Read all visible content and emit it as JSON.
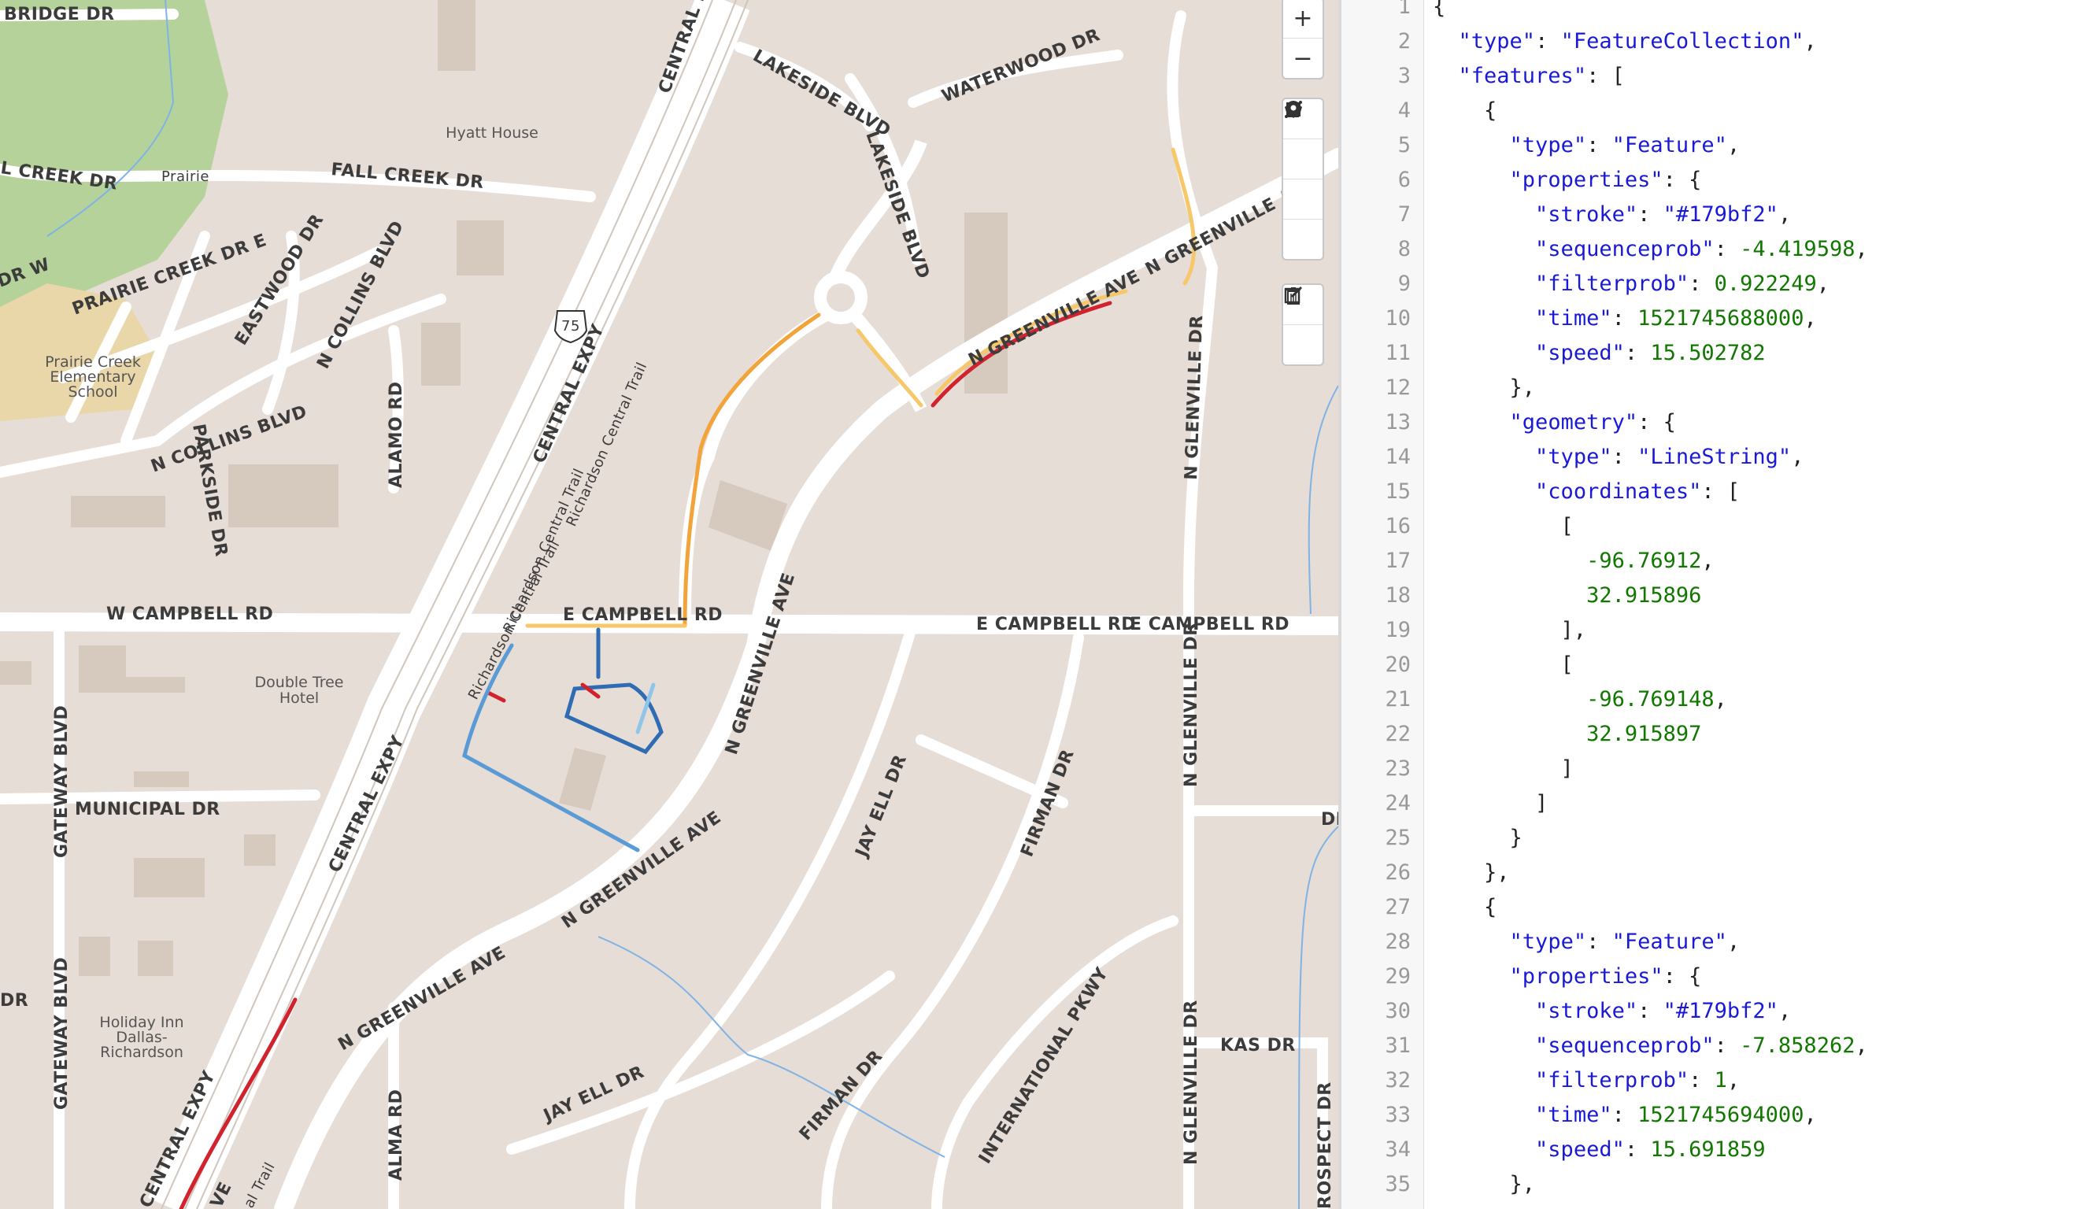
{
  "map": {
    "streets": {
      "bridge_dr": "BRIDGE DR",
      "fall_creek_dr_left": "L CREEK DR",
      "prairie_label": "Prairie",
      "fall_creek_dr": "FALL CREEK DR",
      "prairie_creek_dr_e": "PRAIRIE CREEK DR E",
      "prairie_creek_dr_w": "DR W",
      "eastwood_dr": "EASTWOOD DR",
      "n_collins_blvd_vertical": "N COLLINS BLVD",
      "parkside_dr": "PARKSIDE DR",
      "n_collins_blvd": "N COLLINS BLVD",
      "alamo_rd": "ALAMO RD",
      "central_expy_top": "CENTRAL EX",
      "central_expy_mid": "CENTRAL EXPY",
      "central_expy_low": "CENTRAL EXPY",
      "central_expy_bottom": "CENTRAL EXPY",
      "richardson_trail_1": "Richardson Central Trail",
      "richardson_trail_2": "Richardson Central Trail",
      "richardson_trail_3": "Richardson Central Trail",
      "richardson_trail_4": "al Trail",
      "lakeside_blvd_1": "LAKESIDE BLVD",
      "lakeside_blvd_2": "LAKESIDE BLVD",
      "waterwood_dr": "WATERWOOD DR",
      "n_greenville_ave_ne": "N GREENVILLE AVE",
      "n_greenville_ave_ne2": "N GREENVILLE AVE",
      "n_glenville_dr_top": "N GLENVILLE DR",
      "w_campbell_rd": "W CAMPBELL RD",
      "e_campbell_rd_1": "E CAMPBELL RD",
      "e_campbell_rd_2": "E CAMPBELL RD",
      "e_campbell_rd_3": "E CAMPBELL RD",
      "n_greenville_ave_vertical": "N GREENVILLE AVE",
      "n_greenville_ave_sw": "N GREENVILLE AVE",
      "n_greenville_ave_bottom": "N GREENVILLE AVE",
      "gateway_blvd_top": "GATEWAY BLVD",
      "gateway_blvd_bottom": "GATEWAY BLVD",
      "municipal_dr": "MUNICIPAL DR",
      "jay_ell_dr_1": "JAY ELL DR",
      "jay_ell_dr_2": "JAY ELL DR",
      "firman_dr_1": "FIRMAN DR",
      "firman_dr_2": "FIRMAN DR",
      "n_glenville_dr_mid": "N GLENVILLE DR",
      "n_glenville_dr_bottom": "N GLENVILLE DR",
      "international_pkwy": "INTERNATIONAL PKWY",
      "kas_dr": "KAS DR",
      "rospect_dr": "ROSPECT DR",
      "alma_rd": "ALMA RD",
      "dr_left": "DR",
      "di_right": "DI",
      "ve_bottom": "VE",
      "us75_shield": "75"
    },
    "pois": {
      "hyatt_house": "Hyatt House",
      "school_line1": "Prairie Creek",
      "school_line2": "Elementary",
      "school_line3": "School",
      "doubletree_line1": "Double Tree",
      "doubletree_line2": "Hotel",
      "holiday_line1": "Holiday Inn",
      "holiday_line2": "Dallas-",
      "holiday_line3": "Richardson"
    },
    "controls": {
      "zoom_in": "+",
      "zoom_out": "−"
    },
    "colors": {
      "land": "#e6ddd6",
      "road": "#ffffff",
      "park": "#b5d29a",
      "track_light": "#8ec5e8",
      "track_dark": "#2f6cb3",
      "track_red": "#d2222d",
      "track_orange": "#f2a33a",
      "track_yellow": "#f6c86a"
    }
  },
  "editor": {
    "lines": [
      "{",
      "  \"type\": \"FeatureCollection\",",
      "  \"features\": [",
      "    {",
      "      \"type\": \"Feature\",",
      "      \"properties\": {",
      "        \"stroke\": \"#179bf2\",",
      "        \"sequenceprob\": -4.419598,",
      "        \"filterprob\": 0.922249,",
      "        \"time\": 1521745688000,",
      "        \"speed\": 15.502782",
      "      },",
      "      \"geometry\": {",
      "        \"type\": \"LineString\",",
      "        \"coordinates\": [",
      "          [",
      "            -96.76912,",
      "            32.915896",
      "          ],",
      "          [",
      "            -96.769148,",
      "            32.915897",
      "          ]",
      "        ]",
      "      }",
      "    },",
      "    {",
      "      \"type\": \"Feature\",",
      "      \"properties\": {",
      "        \"stroke\": \"#179bf2\",",
      "        \"sequenceprob\": -7.858262,",
      "        \"filterprob\": 1,",
      "        \"time\": 1521745694000,",
      "        \"speed\": 15.691859",
      "      },"
    ]
  }
}
